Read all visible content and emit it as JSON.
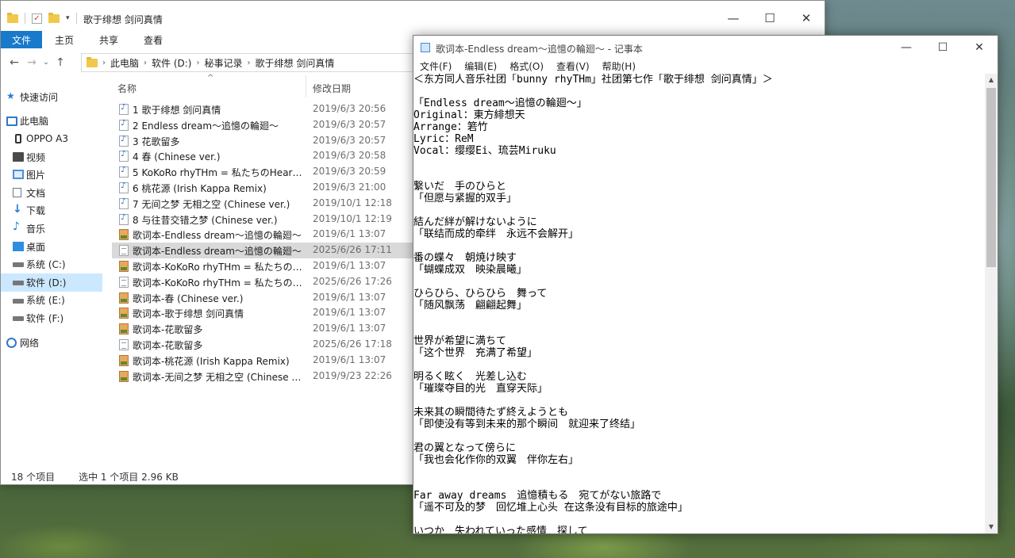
{
  "explorer": {
    "title": "歌于绯想 剑问真情",
    "ribbon_tabs": [
      "文件",
      "主页",
      "共享",
      "查看"
    ],
    "breadcrumbs": [
      "此电脑",
      "软件 (D:)",
      "秘事记录",
      "歌于绯想 剑问真情"
    ],
    "nav_items": [
      {
        "label": "快速访问",
        "icon": "star-icon",
        "level": 0,
        "selected": false
      },
      {
        "label": "此电脑",
        "icon": "computer-icon",
        "level": 0,
        "selected": false
      },
      {
        "label": "OPPO A3",
        "icon": "phone-icon",
        "level": 1,
        "selected": false
      },
      {
        "label": "视频",
        "icon": "video-icon",
        "level": 1,
        "selected": false
      },
      {
        "label": "图片",
        "icon": "pictures-icon",
        "level": 1,
        "selected": false
      },
      {
        "label": "文档",
        "icon": "documents-icon",
        "level": 1,
        "selected": false
      },
      {
        "label": "下载",
        "icon": "download-icon",
        "level": 1,
        "selected": false
      },
      {
        "label": "音乐",
        "icon": "music-icon",
        "level": 1,
        "selected": false
      },
      {
        "label": "桌面",
        "icon": "desktop-icon",
        "level": 1,
        "selected": false
      },
      {
        "label": "系统 (C:)",
        "icon": "drive-icon",
        "level": 1,
        "selected": false
      },
      {
        "label": "软件 (D:)",
        "icon": "drive-icon",
        "level": 1,
        "selected": true
      },
      {
        "label": "系统 (E:)",
        "icon": "drive-icon",
        "level": 1,
        "selected": false
      },
      {
        "label": "软件 (F:)",
        "icon": "drive-icon",
        "level": 1,
        "selected": false
      },
      {
        "label": "网络",
        "icon": "network-icon",
        "level": 0,
        "selected": false
      }
    ],
    "columns": {
      "name": "名称",
      "date": "修改日期"
    },
    "files": [
      {
        "name": "1 歌于绯想 剑问真情",
        "date": "2019/6/3 20:56",
        "type": "audio"
      },
      {
        "name": "2 Endless dream～追憶の輪廻～",
        "date": "2019/6/3 20:57",
        "type": "audio"
      },
      {
        "name": "3 花歌留多",
        "date": "2019/6/3 20:57",
        "type": "audio"
      },
      {
        "name": "4 春 (Chinese ver.)",
        "date": "2019/6/3 20:58",
        "type": "audio"
      },
      {
        "name": "5 KoKoRo rhyTHm = 私たちのHeart B...",
        "date": "2019/6/3 20:59",
        "type": "audio"
      },
      {
        "name": "6 桃花源 (Irish Kappa Remix)",
        "date": "2019/6/3 21:00",
        "type": "audio"
      },
      {
        "name": "7 无间之梦 无相之空 (Chinese ver.)",
        "date": "2019/10/1 12:18",
        "type": "audio"
      },
      {
        "name": "8 与往昔交错之梦 (Chinese ver.)",
        "date": "2019/10/1 12:19",
        "type": "audio"
      },
      {
        "name": "歌词本-Endless dream～追憶の輪廻～",
        "date": "2019/6/1 13:07",
        "type": "img"
      },
      {
        "name": "歌词本-Endless dream～追憶の輪廻～",
        "date": "2025/6/26 17:11",
        "type": "txt",
        "selected": true
      },
      {
        "name": "歌词本-KoKoRo rhyTHm = 私たちのH...",
        "date": "2019/6/1 13:07",
        "type": "img"
      },
      {
        "name": "歌词本-KoKoRo rhyTHm = 私たちのH...",
        "date": "2025/6/26 17:26",
        "type": "txt"
      },
      {
        "name": "歌词本-春 (Chinese ver.)",
        "date": "2019/6/1 13:07",
        "type": "img"
      },
      {
        "name": "歌词本-歌于绯想 剑问真情",
        "date": "2019/6/1 13:07",
        "type": "img"
      },
      {
        "name": "歌词本-花歌留多",
        "date": "2019/6/1 13:07",
        "type": "img"
      },
      {
        "name": "歌词本-花歌留多",
        "date": "2025/6/26 17:18",
        "type": "txt"
      },
      {
        "name": "歌词本-桃花源 (Irish Kappa Remix)",
        "date": "2019/6/1 13:07",
        "type": "img"
      },
      {
        "name": "歌词本-无间之梦 无相之空 (Chinese ver...",
        "date": "2019/9/23 22:26",
        "type": "img"
      }
    ],
    "status": {
      "count": "18 个项目",
      "selection": "选中 1 个项目 2.96 KB"
    }
  },
  "notepad": {
    "title": "歌词本-Endless dream～追憶の輪廻～ - 记事本",
    "menu": [
      "文件(F)",
      "编辑(E)",
      "格式(O)",
      "查看(V)",
      "帮助(H)"
    ],
    "lines": [
      "＜东方同人音乐社团「bunny rhyTHm」社团第七作「歌于绯想 剑问真情」＞",
      "",
      "「Endless dream～追憶の輪廻～」",
      "Original：東方緋想天",
      "Arrange：箬竹",
      "Lyric：ReM",
      "Vocal：缨缨Ei、琉芸Miruku",
      "",
      "",
      "繋いだ　手のひらと",
      "「但愿与紧握的双手」",
      "",
      "結んだ絆が解けないように",
      "「联结而成的牵绊　永远不会解开」",
      "",
      "番の蝶々　朝焼け映す",
      "「蝴蝶成双　映染晨曦」",
      "",
      "ひらひら、ひらひら　舞って",
      "「随风飘荡　翩翩起舞」",
      "",
      "",
      "世界が希望に満ちて",
      "「这个世界　充满了希望」",
      "",
      "明るく眩く　光差し込む",
      "「璀璨夺目的光　直穿天际」",
      "",
      "未来其の瞬間待たず終えようとも",
      "「即使没有等到未来的那个瞬间　就迎来了终结」",
      "",
      "君の翼となって傍らに",
      "「我也会化作你的双翼　伴你左右」",
      "",
      "",
      "Far away dreams　追憶積もる　宛てがない旅路で",
      "「遥不可及的梦　回忆堆上心头 在这条没有目标的旅途中」",
      "",
      "いつか　失われていった感情　探して"
    ]
  }
}
